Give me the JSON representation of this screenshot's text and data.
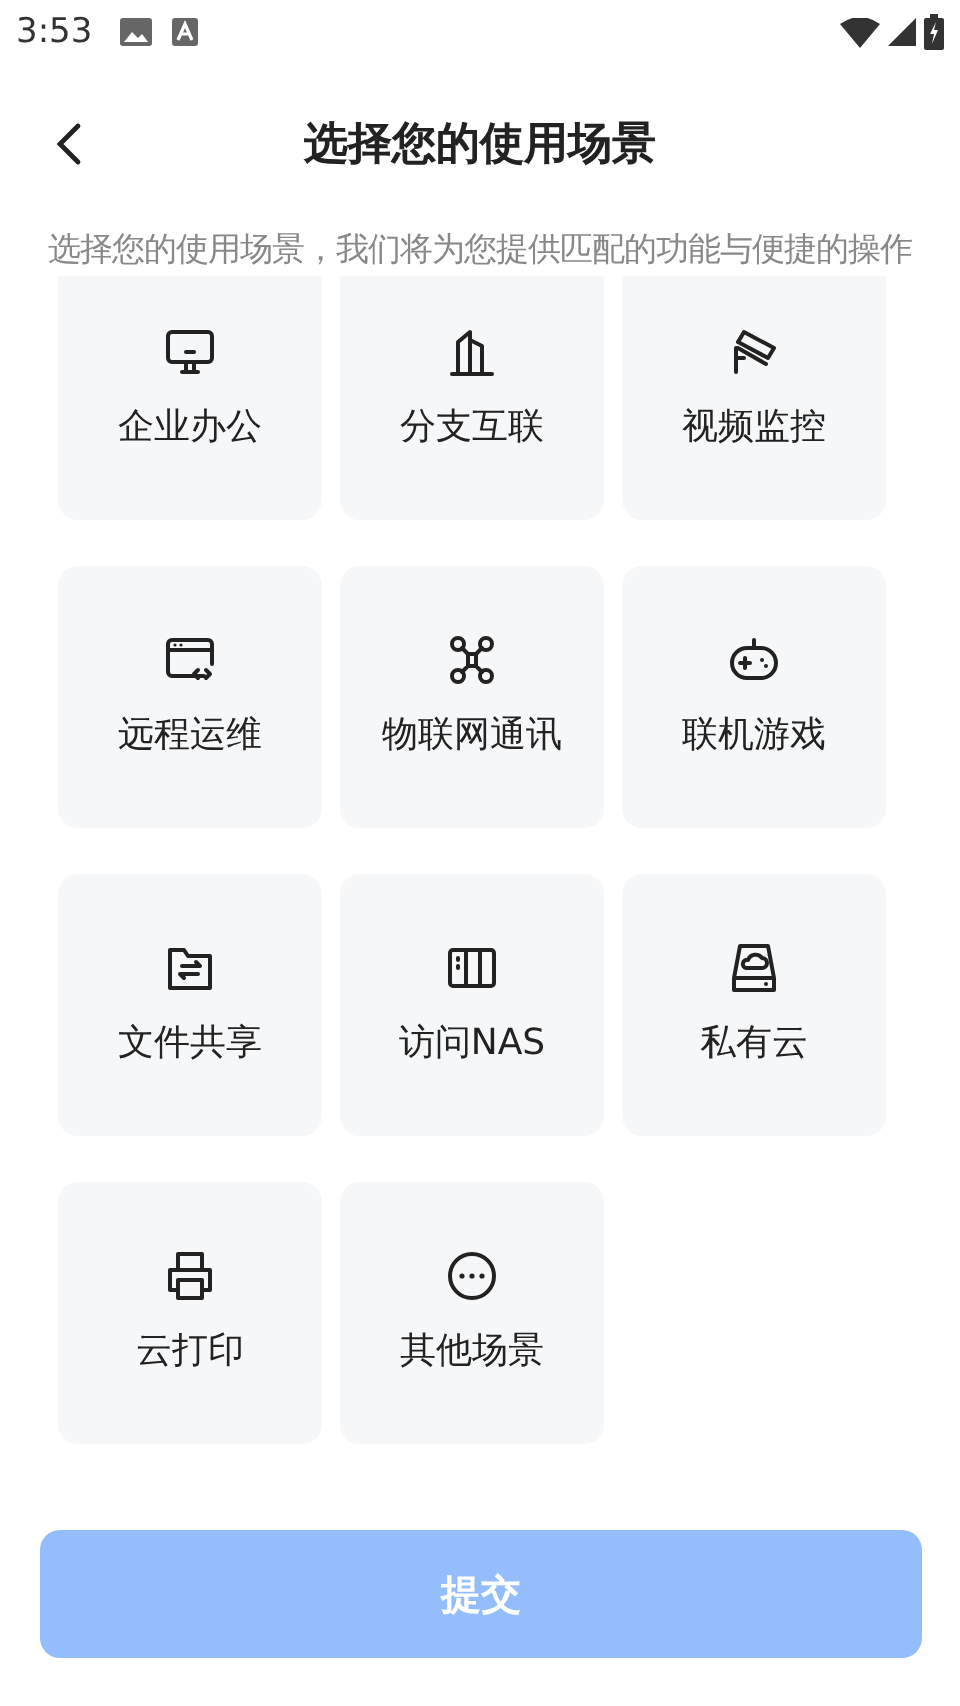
{
  "status_bar": {
    "time": "3:53"
  },
  "header": {
    "title": "选择您的使用场景"
  },
  "subtitle": "选择您的使用场景，我们将为您提供匹配的功能与便捷的操作",
  "scenarios": [
    {
      "label": "企业办公"
    },
    {
      "label": "分支互联"
    },
    {
      "label": "视频监控"
    },
    {
      "label": "远程运维"
    },
    {
      "label": "物联网通讯"
    },
    {
      "label": "联机游戏"
    },
    {
      "label": "文件共享"
    },
    {
      "label": "访问NAS"
    },
    {
      "label": "私有云"
    },
    {
      "label": "云打印"
    },
    {
      "label": "其他场景"
    }
  ],
  "submit_button": {
    "label": "提交",
    "disabled": true
  }
}
